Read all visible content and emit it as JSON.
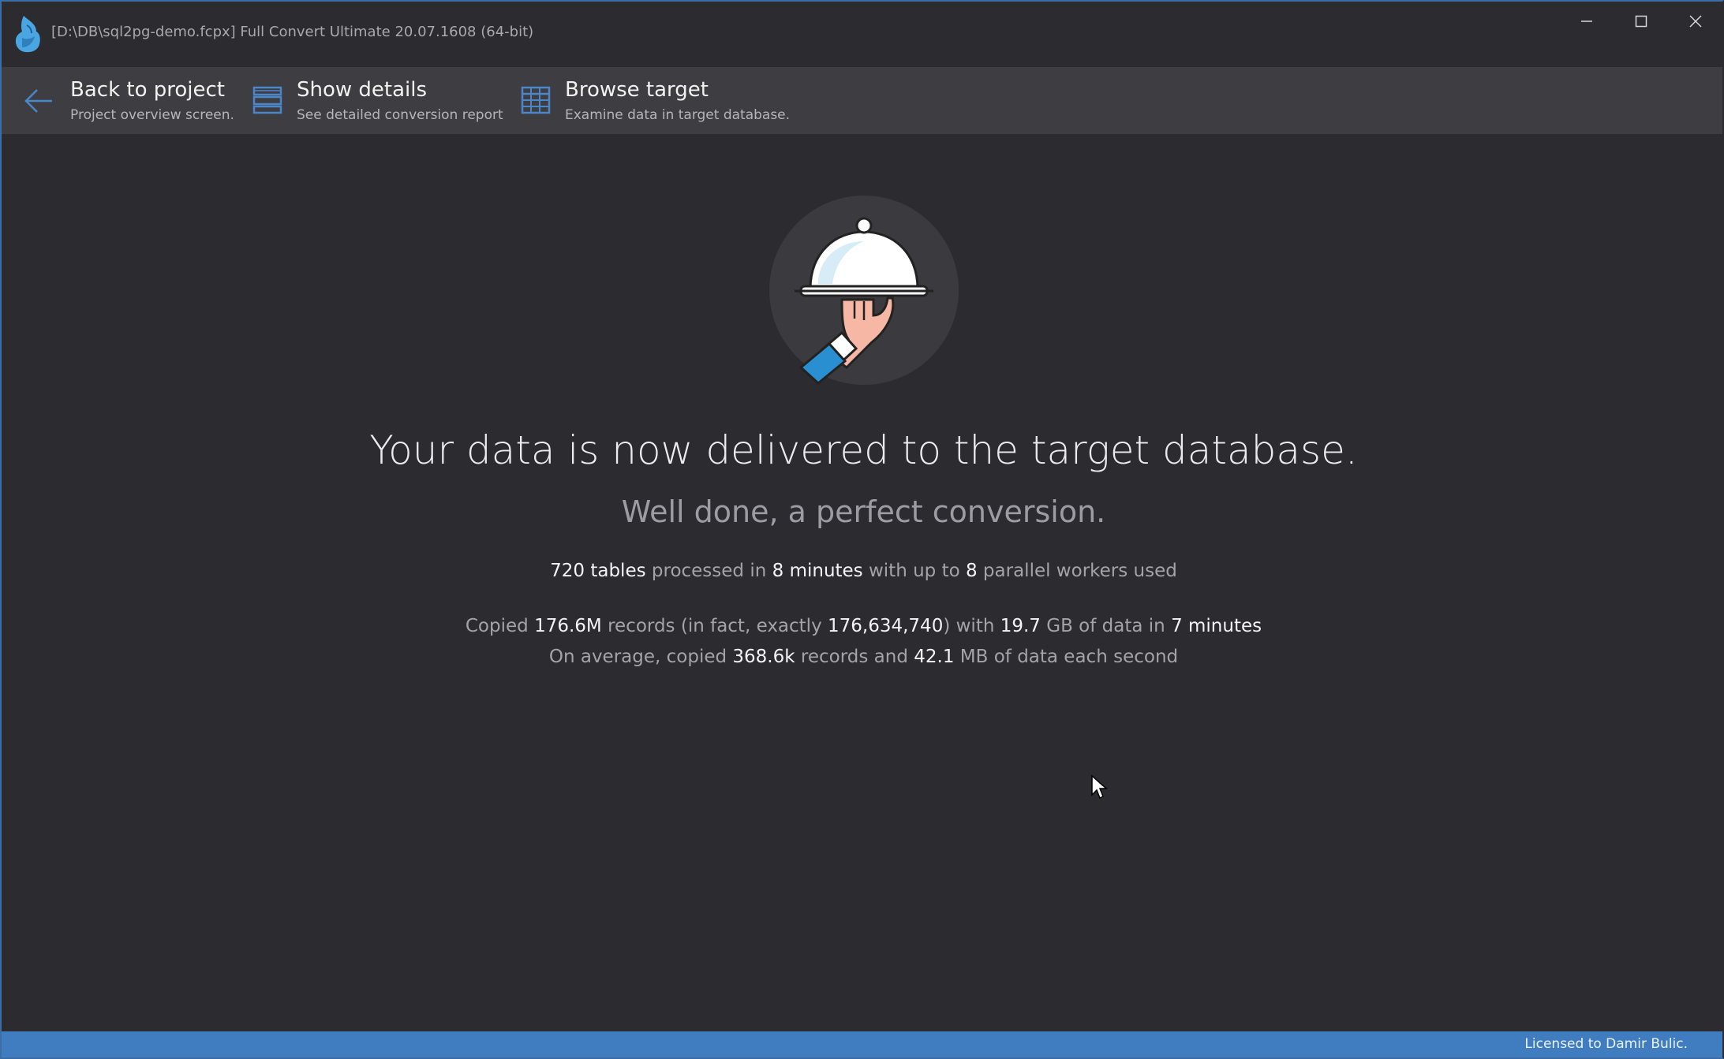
{
  "window": {
    "title": "[D:\\DB\\sql2pg-demo.fcpx] Full Convert Ultimate 20.07.1608 (64-bit)",
    "controls": {
      "minimize_icon": "minimize-icon",
      "maximize_icon": "maximize-icon",
      "close_icon": "close-icon"
    }
  },
  "toolbar": {
    "back": {
      "label": "Back to project",
      "sub": "Project overview screen.",
      "icon": "back-arrow-icon"
    },
    "details": {
      "label": "Show details",
      "sub": "See detailed conversion report",
      "icon": "details-list-icon"
    },
    "browse": {
      "label": "Browse target",
      "sub": "Examine data in target database.",
      "icon": "table-grid-icon"
    }
  },
  "main": {
    "illustration": "serving-cloche-icon",
    "headline": "Your data is now delivered to the target database.",
    "subline": "Well done, a perfect conversion.",
    "stats1": {
      "tables": "720 tables",
      "t1": " processed in ",
      "minutes": "8 minutes",
      "t2": " with up to ",
      "workers": "8",
      "t3": " parallel workers used"
    },
    "stats2": {
      "t0": "Copied ",
      "records_short": "176.6M",
      "t1": " records (in fact, exactly ",
      "records_exact": "176,634,740",
      "t2": ") with ",
      "size": "19.7",
      "t3": " GB of data in ",
      "minutes": "7 minutes"
    },
    "stats3": {
      "t0": "On average, copied ",
      "rate": "368.6k",
      "t1": " records and ",
      "mb": "42.1",
      "t2": " MB of data each second"
    }
  },
  "status": {
    "license": "Licensed to Damir Bulic."
  },
  "colors": {
    "background": "#2b2b30",
    "toolbar": "#3d3d42",
    "accent": "#3f7dc0",
    "icon_blue": "#4a86c8"
  }
}
